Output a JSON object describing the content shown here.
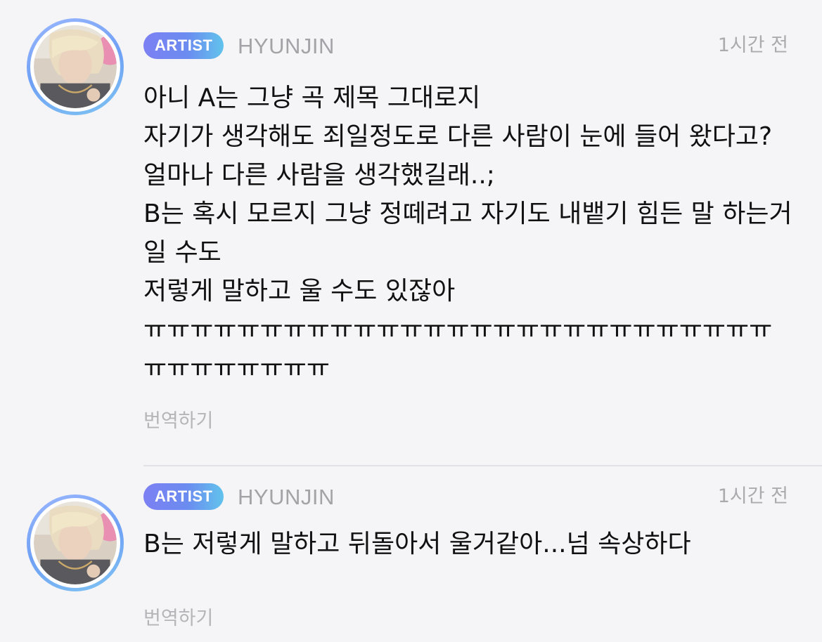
{
  "comments": [
    {
      "badge": "ARTIST",
      "username": "HYUNJIN",
      "time": "1시간 전",
      "text": "아니 A는 그냥 곡 제목 그대로지\n자기가 생각해도 죄일정도로 다른 사람이 눈에 들어 왔다고? 얼마나 다른 사람을 생각했길래..;\nB는 혹시 모르지 그냥 정떼려고 자기도 내뱉기 힘든 말 하는거 일 수도\n저렇게 말하고 울 수도 있잖아\nㅠㅠㅠㅠㅠㅠㅠㅠㅠㅠㅠㅠㅠㅠㅠㅠㅠㅠㅠㅠㅠㅠㅠㅠㅠㅠㅠㅠㅠㅠㅠㅠㅠㅠㅠ",
      "translate": "번역하기"
    },
    {
      "badge": "ARTIST",
      "username": "HYUNJIN",
      "time": "1시간 전",
      "text": "B는 저렇게 말하고 뒤돌아서 울거같아...넘 속상하다",
      "translate": "번역하기"
    }
  ],
  "colors": {
    "background": "#f5f5f7",
    "badge_gradient_start": "#7c80f2",
    "badge_gradient_end": "#61c3ec",
    "muted_text": "#a3a3a8",
    "avatar_ring": "#6fa0f5"
  }
}
